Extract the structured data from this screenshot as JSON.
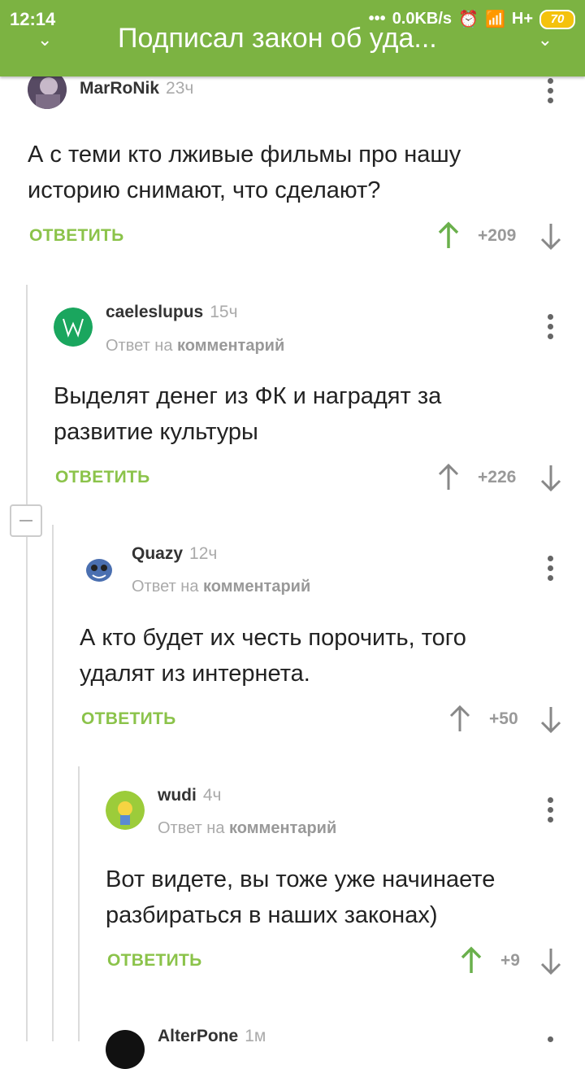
{
  "status_bar": {
    "time": "12:14",
    "network": "0.0KB/s",
    "signal": "H+",
    "battery": "70"
  },
  "header": {
    "title": "Подписал закон об уда..."
  },
  "comments": [
    {
      "author": "MarRoNik",
      "time": "23ч",
      "text": "А с теми кто лживые фильмы про нашу историю снимают, что сделают?",
      "reply_label": "ОТВЕТИТЬ",
      "rating": "+209"
    },
    {
      "author": "caeleslupus",
      "time": "15ч",
      "reply_prefix": "Ответ на",
      "reply_target": "комментарий",
      "text": "Выделят денег из ФК и наградят за развитие культуры",
      "reply_label": "ОТВЕТИТЬ",
      "rating": "+226"
    },
    {
      "author": "Quazy",
      "time": "12ч",
      "reply_prefix": "Ответ на",
      "reply_target": "комментарий",
      "text": "А кто будет их честь порочить, того удалят из интернета.",
      "reply_label": "ОТВЕТИТЬ",
      "rating": "+50"
    },
    {
      "author": "wudi",
      "time": "4ч",
      "reply_prefix": "Ответ на",
      "reply_target": "комментарий",
      "text": "Вот видете, вы тоже уже начинаете разбираться в наших законах)",
      "reply_label": "ОТВЕТИТЬ",
      "rating": "+9"
    },
    {
      "author": "AlterPone",
      "time": "1м"
    }
  ],
  "colors": {
    "accent": "#7cb342",
    "reply": "#8bc34a",
    "upvote_active": "#6ab04c",
    "muted": "#999999"
  }
}
